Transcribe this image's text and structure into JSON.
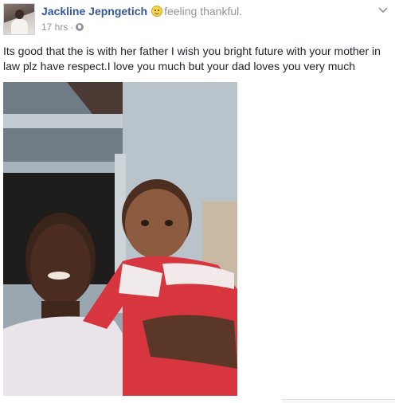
{
  "post": {
    "author": "Jackline Jepngetich",
    "feeling_emoji": "smiley-emoji-icon",
    "activity": "feeling thankful.",
    "timestamp": "17 hrs",
    "separator": "·",
    "privacy_icon": "globe-icon",
    "menu_icon": "chevron-down-icon",
    "text": "Its good that the is with her father I wish you bright future with your mother in law plz have respect.I love you much but your dad loves you very much",
    "photo": "photo of a woman holding a baby in a red outfit"
  },
  "colors": {
    "author_link": "#365899",
    "meta_gray": "#90949c",
    "text": "#1d2129"
  }
}
